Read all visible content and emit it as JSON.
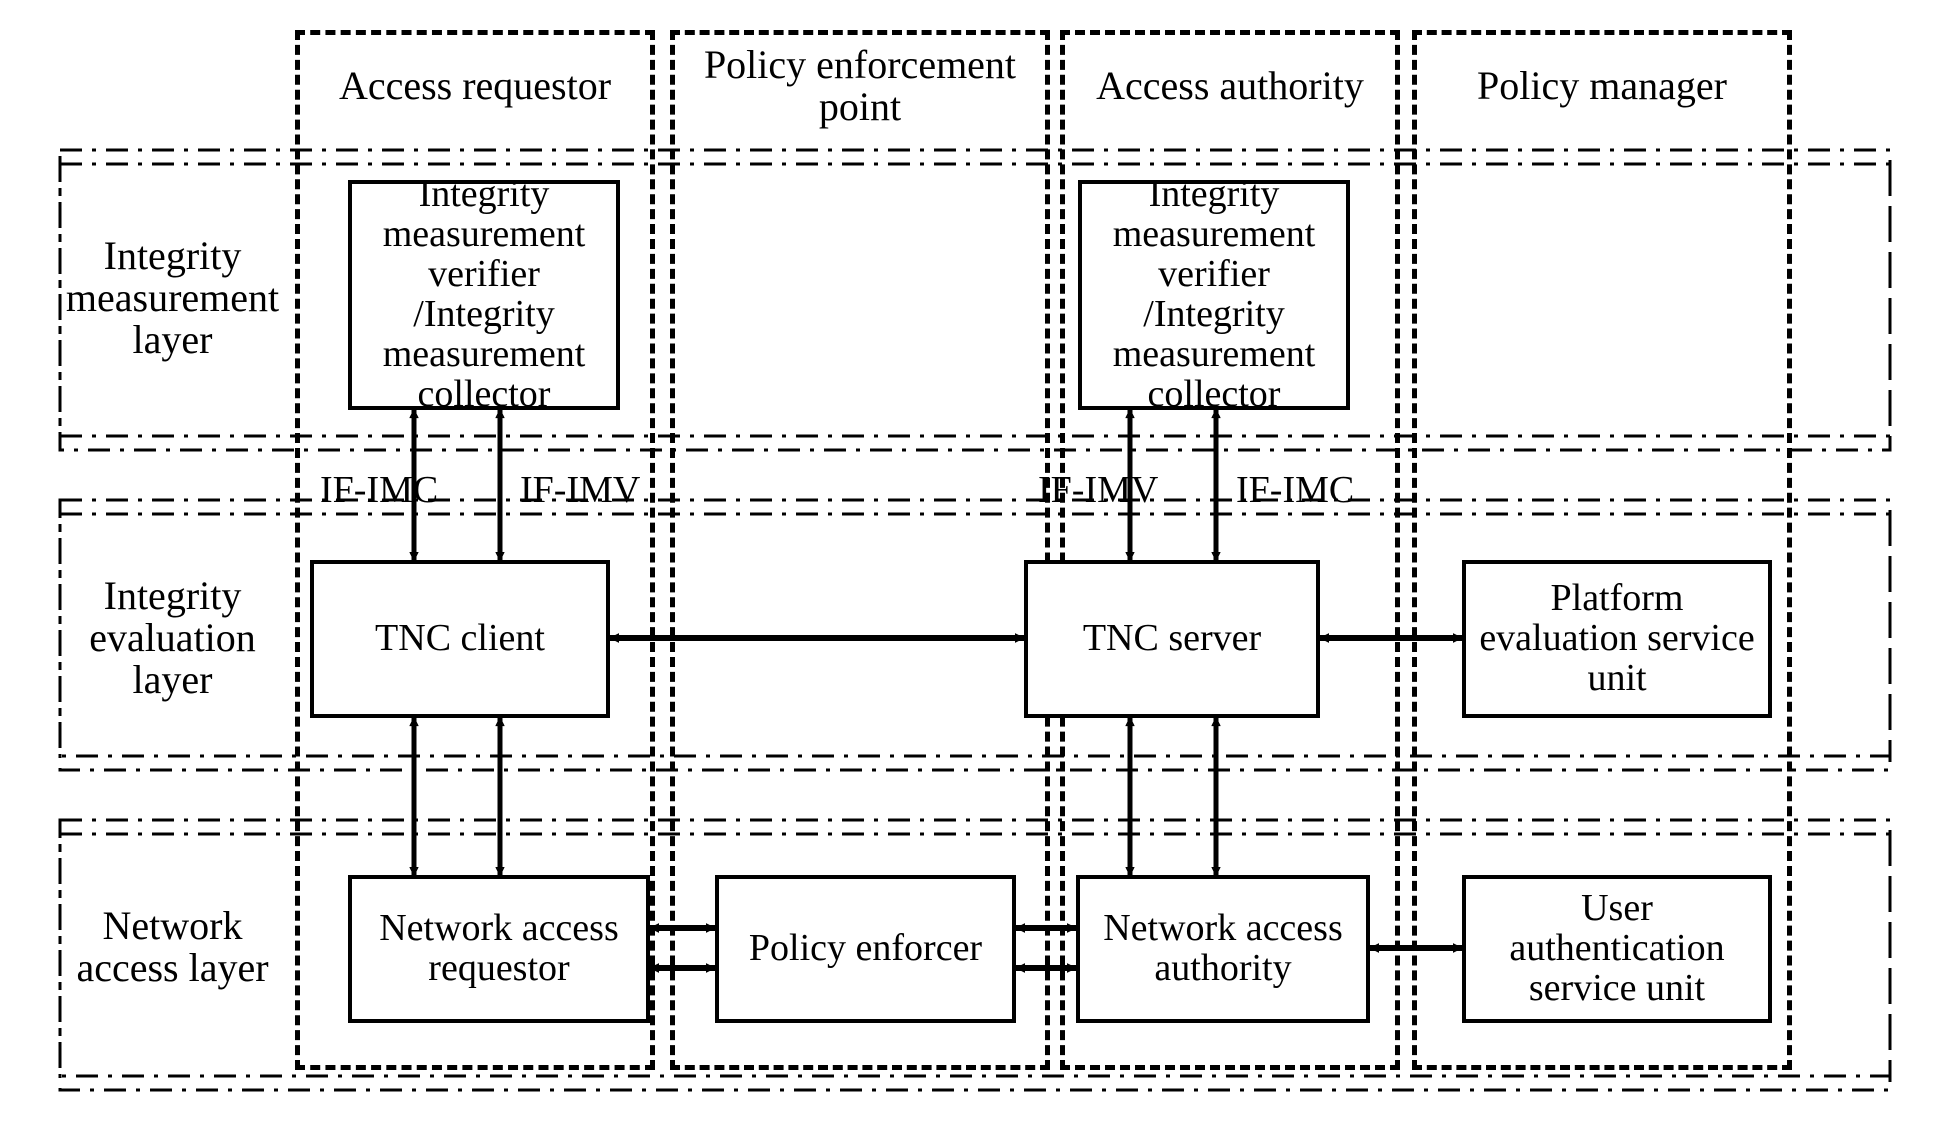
{
  "columns": {
    "access_requestor": "Access requestor",
    "policy_enforcement_point": "Policy enforcement point",
    "access_authority": "Access authority",
    "policy_manager": "Policy manager"
  },
  "rows": {
    "integrity_measurement_layer": "Integrity measurement layer",
    "integrity_evaluation_layer": "Integrity evaluation layer",
    "network_access_layer": "Network access layer"
  },
  "nodes": {
    "imv_imc_left": "Integrity measurement verifier /Integrity measurement collector",
    "imv_imc_right": "Integrity measurement verifier /Integrity measurement collector",
    "tnc_client": "TNC client",
    "tnc_server": "TNC server",
    "platform_eval_service": "Platform evaluation service unit",
    "net_access_requestor": "Network access requestor",
    "policy_enforcer": "Policy enforcer",
    "net_access_authority": "Network access authority",
    "user_auth_service": "User authentication service unit"
  },
  "interfaces": {
    "left_if_imc": "IF-IMC",
    "left_if_imv": "IF-IMV",
    "right_if_imv": "IF-IMV",
    "right_if_imc": "IF-IMC"
  }
}
